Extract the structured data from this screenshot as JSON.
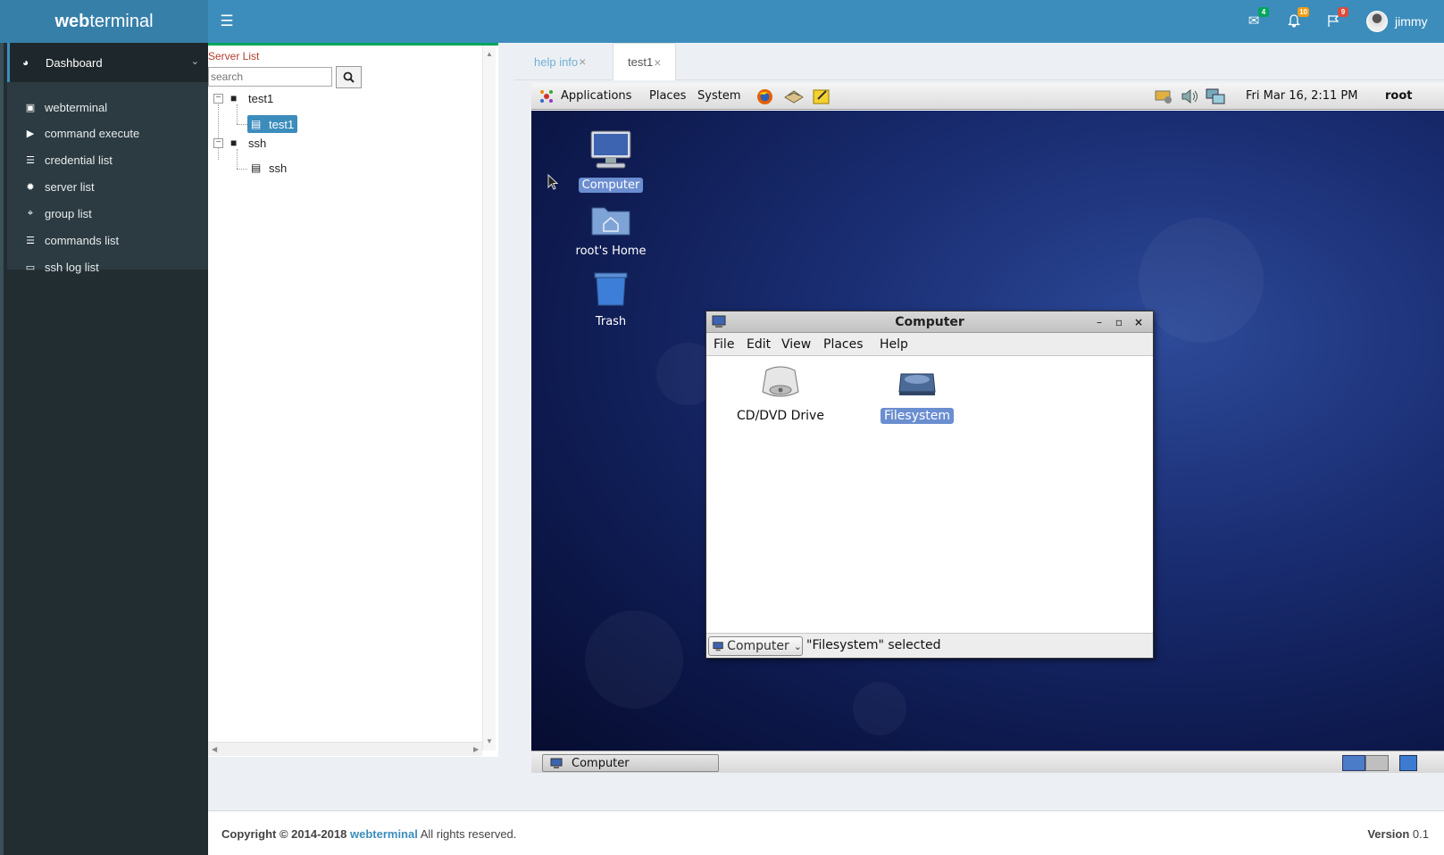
{
  "header": {
    "logo_bold": "web",
    "logo_rest": "terminal",
    "messages_badge": "4",
    "notifications_badge": "10",
    "tasks_badge": "9",
    "user_name": "jimmy",
    "colors": {
      "header": "#3c8dbc",
      "logo_bg": "#367fa9"
    }
  },
  "sidebar": {
    "dashboard_label": "Dashboard",
    "items": [
      {
        "label": "webterminal",
        "icon": "laptop-icon"
      },
      {
        "label": "command execute",
        "icon": "play-icon"
      },
      {
        "label": "credential list",
        "icon": "list-icon"
      },
      {
        "label": "server list",
        "icon": "gear-icon"
      },
      {
        "label": "group list",
        "icon": "crop-icon"
      },
      {
        "label": "commands list",
        "icon": "list-icon"
      },
      {
        "label": "ssh log list",
        "icon": "monitor-icon"
      }
    ]
  },
  "server_panel": {
    "title": "Server List",
    "search_placeholder": "search",
    "tree": [
      {
        "label": "test1",
        "children": [
          {
            "label": "test1",
            "selected": true
          }
        ]
      },
      {
        "label": "ssh",
        "children": [
          {
            "label": "ssh",
            "selected": false
          }
        ]
      }
    ]
  },
  "tabs": [
    {
      "label": "help info",
      "active": false
    },
    {
      "label": "test1",
      "active": true
    }
  ],
  "remote_desktop": {
    "top_panel": {
      "menus": [
        "Applications",
        "Places",
        "System"
      ],
      "clock": "Fri Mar 16,  2:11 PM",
      "user": "root"
    },
    "desktop_icons": [
      {
        "label": "Computer",
        "icon": "computer-icon",
        "selected": true
      },
      {
        "label": "root's Home",
        "icon": "home-folder-icon",
        "selected": false
      },
      {
        "label": "Trash",
        "icon": "trash-icon",
        "selected": false
      }
    ],
    "window": {
      "title": "Computer",
      "menus": [
        "File",
        "Edit",
        "View",
        "Places",
        "Help"
      ],
      "items": [
        {
          "label": "CD/DVD Drive",
          "icon": "cd-drive-icon",
          "selected": false
        },
        {
          "label": "Filesystem",
          "icon": "harddisk-icon",
          "selected": true
        }
      ],
      "location_select": "Computer",
      "status": "\"Filesystem\" selected"
    },
    "taskbar": {
      "button_label": "Computer"
    }
  },
  "footer": {
    "copyright_prefix": "Copyright © 2014-2018",
    "brand": "webterminal",
    "rights": "All rights reserved.",
    "version_label": "Version",
    "version_value": "0.1"
  }
}
